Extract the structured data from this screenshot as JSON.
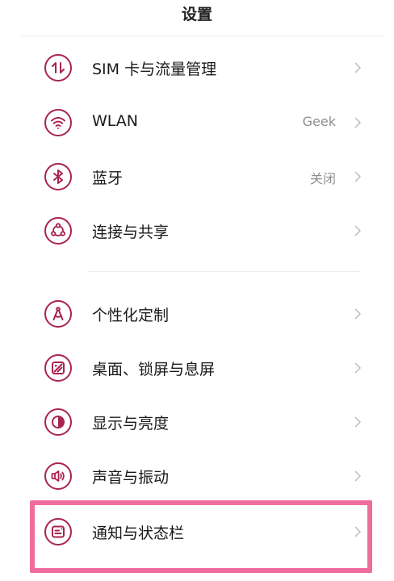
{
  "header": {
    "title": "设置"
  },
  "accent_color": "#a8234f",
  "highlight_color": "#ef6d9c",
  "items": [
    {
      "label": "SIM 卡与流量管理",
      "value": "",
      "icon": "sim-data-icon"
    },
    {
      "label": "WLAN",
      "value": "Geek",
      "icon": "wifi-icon"
    },
    {
      "label": "蓝牙",
      "value": "关闭",
      "icon": "bluetooth-icon"
    },
    {
      "label": "连接与共享",
      "value": "",
      "icon": "share-connection-icon"
    },
    {
      "label": "个性化定制",
      "value": "",
      "icon": "personalization-icon"
    },
    {
      "label": "桌面、锁屏与息屏",
      "value": "",
      "icon": "wallpaper-icon"
    },
    {
      "label": "显示与亮度",
      "value": "",
      "icon": "display-brightness-icon"
    },
    {
      "label": "声音与振动",
      "value": "",
      "icon": "sound-icon"
    },
    {
      "label": "通知与状态栏",
      "value": "",
      "icon": "notification-icon"
    }
  ]
}
